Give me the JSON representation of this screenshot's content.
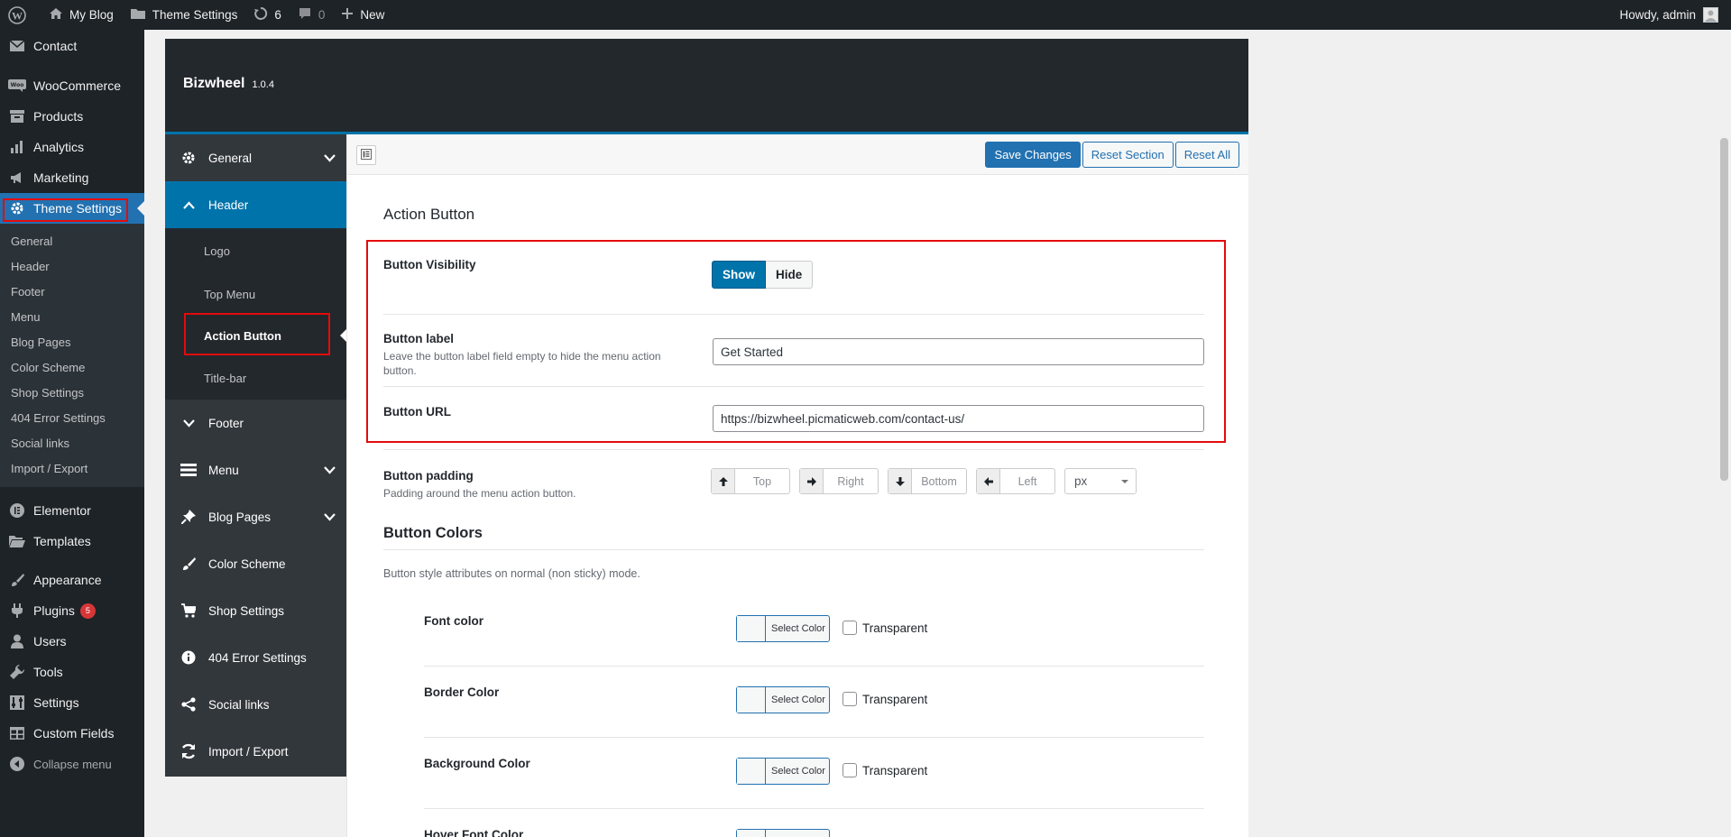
{
  "adminbar": {
    "site_name": "My Blog",
    "theme_settings": "Theme Settings",
    "updates_count": "6",
    "comments_count": "0",
    "new_label": "New",
    "howdy": "Howdy, admin"
  },
  "admin_menu": {
    "contact": "Contact",
    "woocommerce": "WooCommerce",
    "products": "Products",
    "analytics": "Analytics",
    "marketing": "Marketing",
    "theme_settings": "Theme Settings",
    "submenu": [
      "General",
      "Header",
      "Footer",
      "Menu",
      "Blog Pages",
      "Color Scheme",
      "Shop Settings",
      "404 Error Settings",
      "Social links",
      "Import / Export"
    ],
    "elementor": "Elementor",
    "templates": "Templates",
    "appearance": "Appearance",
    "plugins": "Plugins",
    "plugins_badge": "5",
    "users": "Users",
    "tools": "Tools",
    "settings": "Settings",
    "custom_fields": "Custom Fields",
    "collapse": "Collapse menu"
  },
  "panel": {
    "title": "Bizwheel",
    "version": "1.0.4"
  },
  "redux_nav": {
    "general": "General",
    "header": "Header",
    "header_sub": {
      "logo": "Logo",
      "top_menu": "Top Menu",
      "action_button": "Action Button",
      "title_bar": "Title-bar"
    },
    "footer": "Footer",
    "menu": "Menu",
    "blog_pages": "Blog Pages",
    "color_scheme": "Color Scheme",
    "shop_settings": "Shop Settings",
    "error_settings": "404 Error Settings",
    "social_links": "Social links",
    "import_export": "Import / Export"
  },
  "toolbar": {
    "save": "Save Changes",
    "reset_section": "Reset Section",
    "reset_all": "Reset All"
  },
  "main": {
    "section_title": "Action Button",
    "visibility_label": "Button Visibility",
    "show": "Show",
    "hide": "Hide",
    "label_label": "Button label",
    "label_desc": "Leave the button label field empty to hide the menu action button.",
    "label_value": "Get Started",
    "url_label": "Button URL",
    "url_value": "https://bizwheel.picmaticweb.com/contact-us/",
    "padding_label": "Button padding",
    "padding_desc": "Padding around the menu action button.",
    "padding_top": "Top",
    "padding_right": "Right",
    "padding_bottom": "Bottom",
    "padding_left": "Left",
    "padding_unit": "px",
    "colors_title": "Button Colors",
    "colors_desc": "Button style attributes on normal (non sticky) mode.",
    "font_color": "Font color",
    "border_color": "Border Color",
    "background_color": "Background Color",
    "hover_font_color": "Hover Font Color",
    "select_color": "Select Color",
    "transparent": "Transparent"
  },
  "colors": {
    "wp_dark": "#1d2327",
    "wp_blue": "#2271b1",
    "redux_blue": "#0073aa",
    "highlight_red": "#e30b0b"
  }
}
